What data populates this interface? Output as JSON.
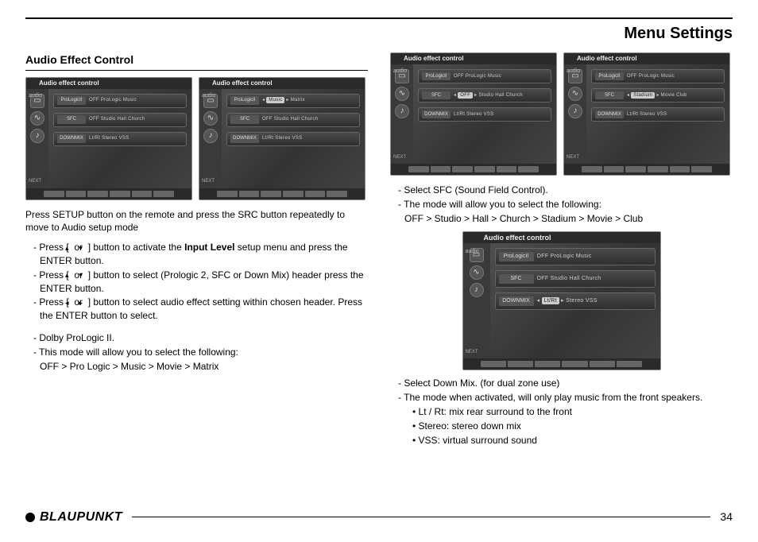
{
  "page": {
    "title": "Menu Settings",
    "section_title": "Audio Effect Control",
    "brand": "BLAUPUNKT",
    "page_number": "34"
  },
  "screenshots": {
    "panel_title": "Audio effect control",
    "audio_label": "audio",
    "next_label": "NEXT",
    "s1": {
      "r1_lbl": "ProLogicII",
      "r1_vals": "OFF  ProLogic  Music",
      "r2_lbl": "SFC",
      "r2_vals": "OFF  Studio  Hall  Church",
      "r3_lbl": "DOWNMIX",
      "r3_vals": "Lt/Rt  Stereo  VSS"
    },
    "s2": {
      "r1_lbl": "ProLogicII",
      "r1_hl": "Music",
      "r1_vals": "Matrix",
      "r2_lbl": "SFC",
      "r2_vals": "OFF  Studio  Hall  Church",
      "r3_lbl": "DOWNMIX",
      "r3_vals": "Lt/Rt  Stereo  VSS"
    },
    "s3": {
      "r1_lbl": "ProLogicII",
      "r1_vals": "OFF  ProLogic  Music",
      "r2_lbl": "SFC",
      "r2_hl": "OFF",
      "r2_vals": "Studio  Hall  Church",
      "r3_lbl": "DOWNMIX",
      "r3_vals": "Lt/Rt  Stereo  VSS"
    },
    "s4": {
      "r1_lbl": "ProLogicII",
      "r1_vals": "OFF  ProLogic  Music",
      "r2_lbl": "SFC",
      "r2_hl": "Stadium",
      "r2_vals": "Movie  Club",
      "r3_lbl": "DOWNMIX",
      "r3_vals": "Lt/Rt  Stereo  VSS"
    },
    "s5": {
      "r1_lbl": "ProLogicII",
      "r1_vals": "OFF  ProLogic  Music",
      "r2_lbl": "SFC",
      "r2_vals": "OFF  Studio  Hall  Church",
      "r3_lbl": "DOWNMIX",
      "r3_hl": "Lt/Rt",
      "r3_vals": "Stereo  VSS"
    }
  },
  "left_text": {
    "intro": "Press SETUP button on the remote and press the SRC button repeatedly to move to Audio setup mode",
    "b1a": "- Press [ ",
    "b1b": " ] button to activate the ",
    "b1_bold": "Input Level",
    "b1c": " setup menu and press the ENTER button.",
    "b2a": "- Press [ ",
    "b2b": " ] button to select (Prologic 2, SFC or Down Mix) header press the ENTER button.",
    "b3a": "- Press [ ",
    "b3b": " ] button to select audio effect setting within chosen header. Press the ENTER button to select.",
    "or": " or ",
    "d1": "- Dolby ProLogic II.",
    "d2": "- This mode will allow you to select the following:",
    "d3": "OFF > Pro Logic > Music > Movie > Matrix"
  },
  "right_text": {
    "s1": "- Select SFC (Sound Field Control).",
    "s2": "- The mode will allow you to select the following:",
    "s3": "OFF > Studio > Hall > Church > Stadium > Movie > Club",
    "m1": "- Select Down Mix. (for dual zone use)",
    "m2": "- The mode when activated, will only play music from the front speakers.",
    "b1": "• Lt / Rt: mix rear surround to the front",
    "b2": "• Stereo: stereo down mix",
    "b3": "• VSS: virtual surround sound"
  }
}
